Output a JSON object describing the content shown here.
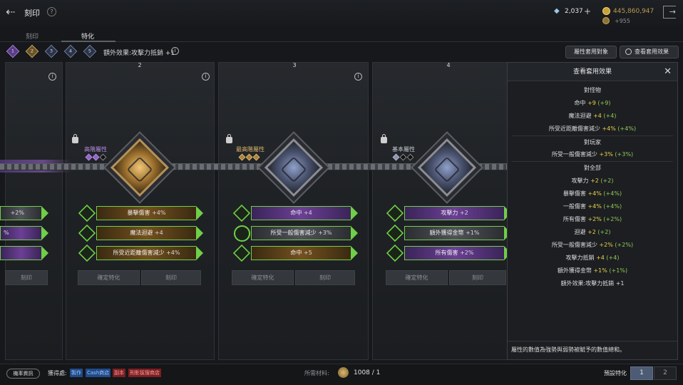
{
  "header": {
    "title": "刻印",
    "gems": "2,037",
    "gold": "445,860,947",
    "gold_bonus": "+955"
  },
  "tabs": [
    {
      "label": "刻印"
    },
    {
      "label": "特化"
    }
  ],
  "levels": [
    "1",
    "2",
    "3",
    "4",
    "5"
  ],
  "extra_effect": "額外效果:攻擊力抵銷 +1",
  "actions": {
    "targets": "屬性套用對象",
    "view_effects": "查看套用效果"
  },
  "cards": [
    {
      "number": "",
      "stats": [
        {
          "name": "",
          "value": "+2%"
        },
        {
          "name": "",
          "value": "%"
        },
        {
          "name": "",
          "value": ""
        }
      ],
      "engrave_btn": "刻印"
    },
    {
      "number": "2",
      "tier_label": "高階屬性",
      "stats": [
        {
          "name": "暴擊傷害",
          "value": "+4%"
        },
        {
          "name": "魔法迴避",
          "value": "+4"
        },
        {
          "name": "所受近距離傷害減少",
          "value": "+4%"
        }
      ],
      "confirm_btn": "確定特化",
      "engrave_btn": "刻印"
    },
    {
      "number": "3",
      "tier_label": "最高階屬性",
      "stats": [
        {
          "name": "命中",
          "value": "+4"
        },
        {
          "name": "所受一般傷害減少",
          "value": "+3%"
        },
        {
          "name": "命中",
          "value": "+5"
        }
      ],
      "confirm_btn": "確定特化",
      "engrave_btn": "刻印"
    },
    {
      "number": "4",
      "tier_label": "基本屬性",
      "stats": [
        {
          "name": "攻擊力",
          "value": "+2"
        },
        {
          "name": "額外獲得金幣",
          "value": "+1%"
        },
        {
          "name": "所有傷害",
          "value": "+2%"
        }
      ],
      "confirm_btn": "確定特化",
      "engrave_btn": "刻印"
    }
  ],
  "panel": {
    "title": "查看套用效果",
    "sections": [
      {
        "title": "對怪物",
        "lines": [
          {
            "name": "命中",
            "val": "+9",
            "paren": "(+9)"
          },
          {
            "name": "魔法迴避",
            "val": "+4",
            "paren": "(+4)"
          },
          {
            "name": "所受近距離傷害減少",
            "val": "+4%",
            "paren": "(+4%)"
          }
        ]
      },
      {
        "title": "對玩家",
        "lines": [
          {
            "name": "所受一般傷害減少",
            "val": "+3%",
            "paren": "(+3%)"
          }
        ]
      },
      {
        "title": "對全部",
        "lines": [
          {
            "name": "攻擊力",
            "val": "+2",
            "paren": "(+2)"
          },
          {
            "name": "暴擊傷害",
            "val": "+4%",
            "paren": "(+4%)"
          },
          {
            "name": "一般傷害",
            "val": "+4%",
            "paren": "(+4%)"
          },
          {
            "name": "所有傷害",
            "val": "+2%",
            "paren": "(+2%)"
          },
          {
            "name": "迴避",
            "val": "+2",
            "paren": "(+2)"
          },
          {
            "name": "所受一般傷害減少",
            "val": "+2%",
            "paren": "(+2%)"
          },
          {
            "name": "攻擊力抵銷",
            "val": "+4",
            "paren": "(+4)"
          },
          {
            "name": "額外獲得金幣",
            "val": "+1%",
            "paren": "(+1%)"
          }
        ]
      }
    ],
    "extra": "額外效果:攻擊力抵銷 +1",
    "footer": "屬性的數值為強勢與弱勢被賦予的數值總和。"
  },
  "bottom": {
    "prob_btn": "機率資訊",
    "obtain_label": "獲得處:",
    "sources": [
      "製作",
      "Cash商店",
      "副本",
      "刑影拔搜商店"
    ],
    "material_label": "所需材料:",
    "material_count": "1008 / 1",
    "preset_label": "預設特化",
    "presets": [
      "1",
      "2"
    ]
  }
}
